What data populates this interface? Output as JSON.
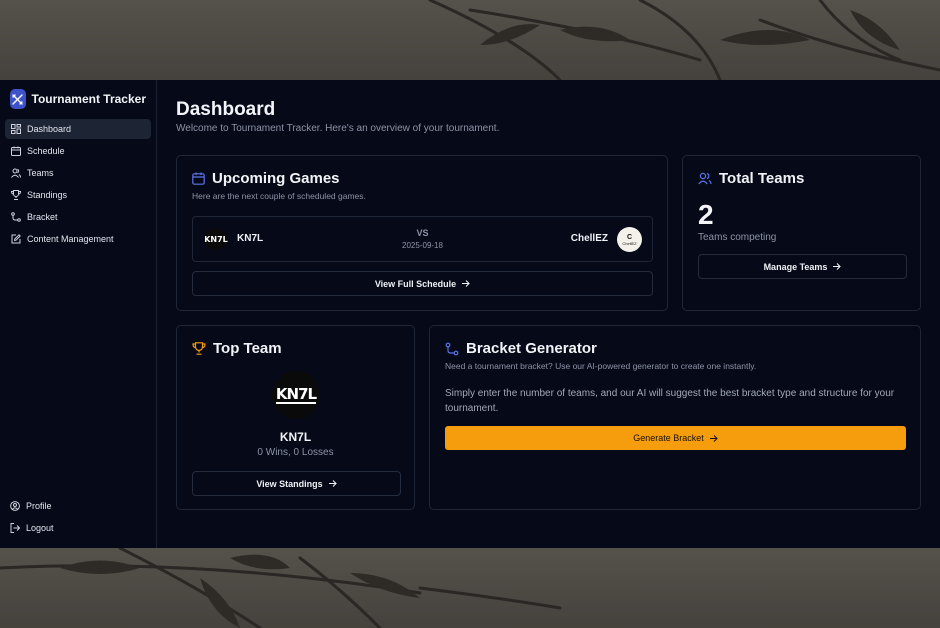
{
  "app": {
    "title": "Tournament Tracker"
  },
  "sidebar": {
    "items": [
      {
        "label": "Dashboard",
        "icon": "dashboard-icon",
        "active": true
      },
      {
        "label": "Schedule",
        "icon": "calendar-icon"
      },
      {
        "label": "Teams",
        "icon": "users-icon"
      },
      {
        "label": "Standings",
        "icon": "trophy-icon"
      },
      {
        "label": "Bracket",
        "icon": "bracket-icon"
      },
      {
        "label": "Content Management",
        "icon": "edit-icon"
      }
    ],
    "bottom": [
      {
        "label": "Profile",
        "icon": "user-circle-icon"
      },
      {
        "label": "Logout",
        "icon": "logout-icon"
      }
    ]
  },
  "header": {
    "title": "Dashboard",
    "subtitle": "Welcome to Tournament Tracker. Here's an overview of your tournament."
  },
  "upcoming": {
    "title": "Upcoming Games",
    "description": "Here are the next couple of scheduled games.",
    "game": {
      "home_logo_text": "KN7L",
      "home_team": "KN7L",
      "vs": "VS",
      "date": "2025-09-18",
      "away_team": "ChellEZ",
      "away_logo_text": "ChellEZ"
    },
    "button": "View Full Schedule"
  },
  "total_teams": {
    "title": "Total Teams",
    "count": "2",
    "label": "Teams competing",
    "button": "Manage Teams"
  },
  "top_team": {
    "title": "Top Team",
    "logo_text": "KN7L",
    "name": "KN7L",
    "record": "0 Wins, 0 Losses",
    "button": "View Standings"
  },
  "bracket": {
    "title": "Bracket Generator",
    "description": "Need a tournament bracket? Use our AI-powered generator to create one instantly.",
    "body": "Simply enter the number of teams, and our AI will suggest the best bracket type and structure for your tournament.",
    "button": "Generate Bracket"
  },
  "colors": {
    "accent_blue": "#3e52c9",
    "accent_orange": "#f59d0c",
    "background": "#060a18"
  }
}
